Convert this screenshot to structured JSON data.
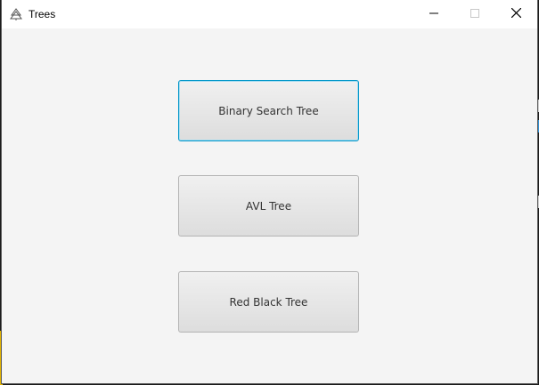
{
  "window": {
    "title": "Trees",
    "icon": "tree-app-icon",
    "controls": {
      "minimize_icon": "minimize-icon",
      "maximize_icon": "maximize-icon",
      "close_icon": "close-icon"
    }
  },
  "buttons": [
    {
      "label": "Binary Search Tree",
      "focused": true
    },
    {
      "label": "AVL Tree",
      "focused": false
    },
    {
      "label": "Red Black Tree",
      "focused": false
    }
  ],
  "colors": {
    "focus_border": "#0096c9",
    "content_bg": "#f4f4f4"
  }
}
